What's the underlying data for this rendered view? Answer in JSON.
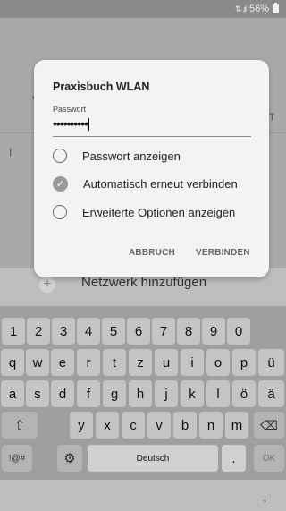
{
  "status_bar": {
    "signal": "⇅ .ıl",
    "battery": "56%"
  },
  "background": {
    "partial_left": "V",
    "partial_right": "T",
    "partial_row": "I",
    "add_network_label": "Netzwerk hinzufügen"
  },
  "dialog": {
    "title": "Praxisbuch WLAN",
    "password_label": "Passwort",
    "password_value": "••••••••••",
    "options": [
      {
        "label": "Passwort anzeigen",
        "checked": false
      },
      {
        "label": "Automatisch erneut verbinden",
        "checked": true
      },
      {
        "label": "Erweiterte Optionen anzeigen",
        "checked": false
      }
    ],
    "cancel_label": "ABBRUCH",
    "connect_label": "VERBINDEN"
  },
  "keyboard": {
    "row1": [
      "1",
      "2",
      "3",
      "4",
      "5",
      "6",
      "7",
      "8",
      "9",
      "0"
    ],
    "row2": [
      "q",
      "w",
      "e",
      "r",
      "t",
      "z",
      "u",
      "i",
      "o",
      "p",
      "ü"
    ],
    "row3": [
      "a",
      "s",
      "d",
      "f",
      "g",
      "h",
      "j",
      "k",
      "l",
      "ö",
      "ä"
    ],
    "row4": [
      "y",
      "x",
      "c",
      "v",
      "b",
      "n",
      "m"
    ],
    "shift": "⇧",
    "backspace": "⌫",
    "symbols": "!@#",
    "settings_icon": "⚙",
    "space": "Deutsch",
    "period": ".",
    "ok": "OK"
  },
  "nav": {
    "hide_keyboard": "↓"
  }
}
